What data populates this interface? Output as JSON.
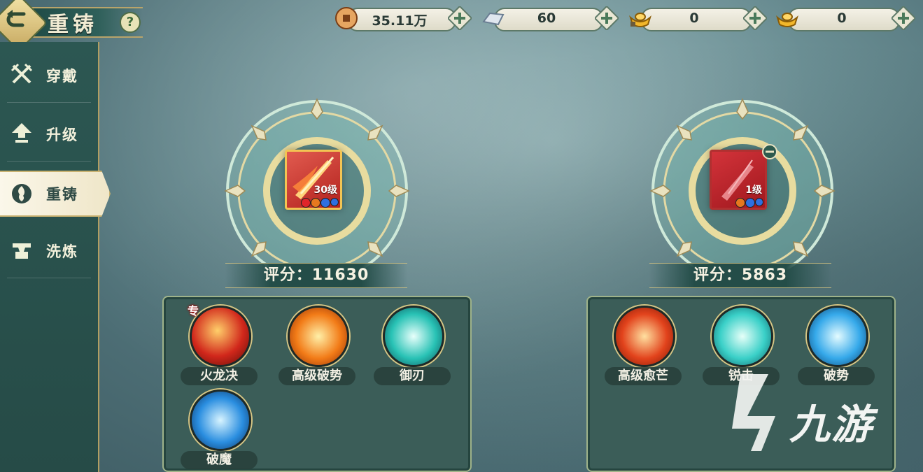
{
  "header": {
    "title": "重铸",
    "help_icon": "question-mark-icon",
    "back_icon": "return-arrow-icon"
  },
  "currency": [
    {
      "icon": "copper-coin-icon",
      "value": "35.11万"
    },
    {
      "icon": "silver-ingot-icon",
      "value": "60"
    },
    {
      "icon": "gold-ingot-locked-icon",
      "value": "0"
    },
    {
      "icon": "gold-ingot-icon",
      "value": "0"
    }
  ],
  "sidebar": {
    "items": [
      {
        "label": "穿戴",
        "icon": "crossed-swords-icon"
      },
      {
        "label": "升级",
        "icon": "upgrade-arrow-icon"
      },
      {
        "label": "重铸",
        "icon": "flame-swirl-icon",
        "active": true
      },
      {
        "label": "洗炼",
        "icon": "anvil-icon"
      }
    ]
  },
  "left_equipment": {
    "level_text": "30级",
    "score_text": "评分：11630",
    "gems": [
      "#e0262a",
      "#e6781f",
      "#2f6fe0",
      "#2f6fe0"
    ],
    "skills": [
      {
        "name": "火龙决",
        "tag": "专",
        "colors": [
          "#ffcf6a",
          "#d1271b",
          "#5a0d08"
        ]
      },
      {
        "name": "高级破势",
        "colors": [
          "#fff0a8",
          "#f27b17",
          "#8a2a06"
        ]
      },
      {
        "name": "御刃",
        "colors": [
          "#e8fffb",
          "#28c2b5",
          "#0b4a52"
        ]
      },
      {
        "name": "破魔",
        "colors": [
          "#d8f4ff",
          "#2a8ee0",
          "#0a2d5c"
        ]
      }
    ]
  },
  "right_equipment": {
    "level_text": "1级",
    "score_text": "评分：5863",
    "gems": [
      "#e6781f",
      "#2f6fe0",
      "#2f6fe0"
    ],
    "skills": [
      {
        "name": "高级愈芒",
        "colors": [
          "#ffe0a0",
          "#e2431c",
          "#7a1605"
        ]
      },
      {
        "name": "锐击",
        "colors": [
          "#e6fff8",
          "#3ad0c8",
          "#0d5a60"
        ]
      },
      {
        "name": "破势",
        "colors": [
          "#e4fbff",
          "#35a9ea",
          "#0b3d6b"
        ]
      }
    ]
  },
  "watermark": {
    "text": "九游"
  },
  "colors": {
    "panel": "#3b5d58",
    "accent_gold": "#d6c685",
    "text_light": "#f4f1dc"
  }
}
